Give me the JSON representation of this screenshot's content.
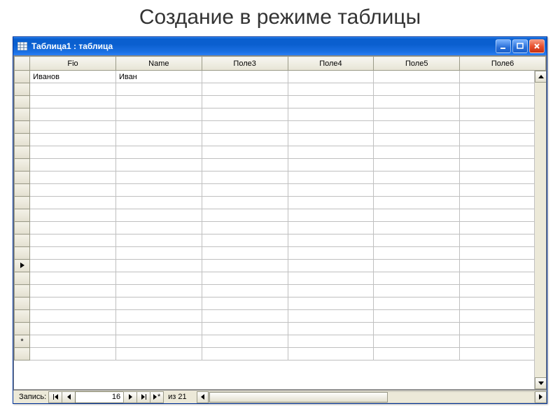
{
  "slide_title": "Создание в режиме таблицы",
  "window": {
    "caption": "Таблица1 : таблица"
  },
  "columns": [
    "Fio",
    "Name",
    "Поле3",
    "Поле4",
    "Поле5",
    "Поле6"
  ],
  "rows": [
    {
      "marker": "",
      "cells": [
        "Иванов",
        "Иван",
        "",
        "",
        "",
        ""
      ]
    },
    {
      "marker": "",
      "cells": [
        "",
        "",
        "",
        "",
        "",
        ""
      ]
    },
    {
      "marker": "",
      "cells": [
        "",
        "",
        "",
        "",
        "",
        ""
      ]
    },
    {
      "marker": "",
      "cells": [
        "",
        "",
        "",
        "",
        "",
        ""
      ]
    },
    {
      "marker": "",
      "cells": [
        "",
        "",
        "",
        "",
        "",
        ""
      ]
    },
    {
      "marker": "",
      "cells": [
        "",
        "",
        "",
        "",
        "",
        ""
      ]
    },
    {
      "marker": "",
      "cells": [
        "",
        "",
        "",
        "",
        "",
        ""
      ]
    },
    {
      "marker": "",
      "cells": [
        "",
        "",
        "",
        "",
        "",
        ""
      ]
    },
    {
      "marker": "",
      "cells": [
        "",
        "",
        "",
        "",
        "",
        ""
      ]
    },
    {
      "marker": "",
      "cells": [
        "",
        "",
        "",
        "",
        "",
        ""
      ]
    },
    {
      "marker": "",
      "cells": [
        "",
        "",
        "",
        "",
        "",
        ""
      ]
    },
    {
      "marker": "",
      "cells": [
        "",
        "",
        "",
        "",
        "",
        ""
      ]
    },
    {
      "marker": "",
      "cells": [
        "",
        "",
        "",
        "",
        "",
        ""
      ]
    },
    {
      "marker": "",
      "cells": [
        "",
        "",
        "",
        "",
        "",
        ""
      ]
    },
    {
      "marker": "",
      "cells": [
        "",
        "",
        "",
        "",
        "",
        ""
      ]
    },
    {
      "marker": "current",
      "cells": [
        "",
        "",
        "",
        "",
        "",
        ""
      ]
    },
    {
      "marker": "",
      "cells": [
        "",
        "",
        "",
        "",
        "",
        ""
      ]
    },
    {
      "marker": "",
      "cells": [
        "",
        "",
        "",
        "",
        "",
        ""
      ]
    },
    {
      "marker": "",
      "cells": [
        "",
        "",
        "",
        "",
        "",
        ""
      ]
    },
    {
      "marker": "",
      "cells": [
        "",
        "",
        "",
        "",
        "",
        ""
      ]
    },
    {
      "marker": "",
      "cells": [
        "",
        "",
        "",
        "",
        "",
        ""
      ]
    },
    {
      "marker": "new",
      "cells": [
        "",
        "",
        "",
        "",
        "",
        ""
      ]
    },
    {
      "marker": "",
      "cells": [
        "",
        "",
        "",
        "",
        "",
        ""
      ]
    }
  ],
  "nav": {
    "label": "Запись:",
    "current": "16",
    "of_label": "из",
    "total": "21"
  }
}
